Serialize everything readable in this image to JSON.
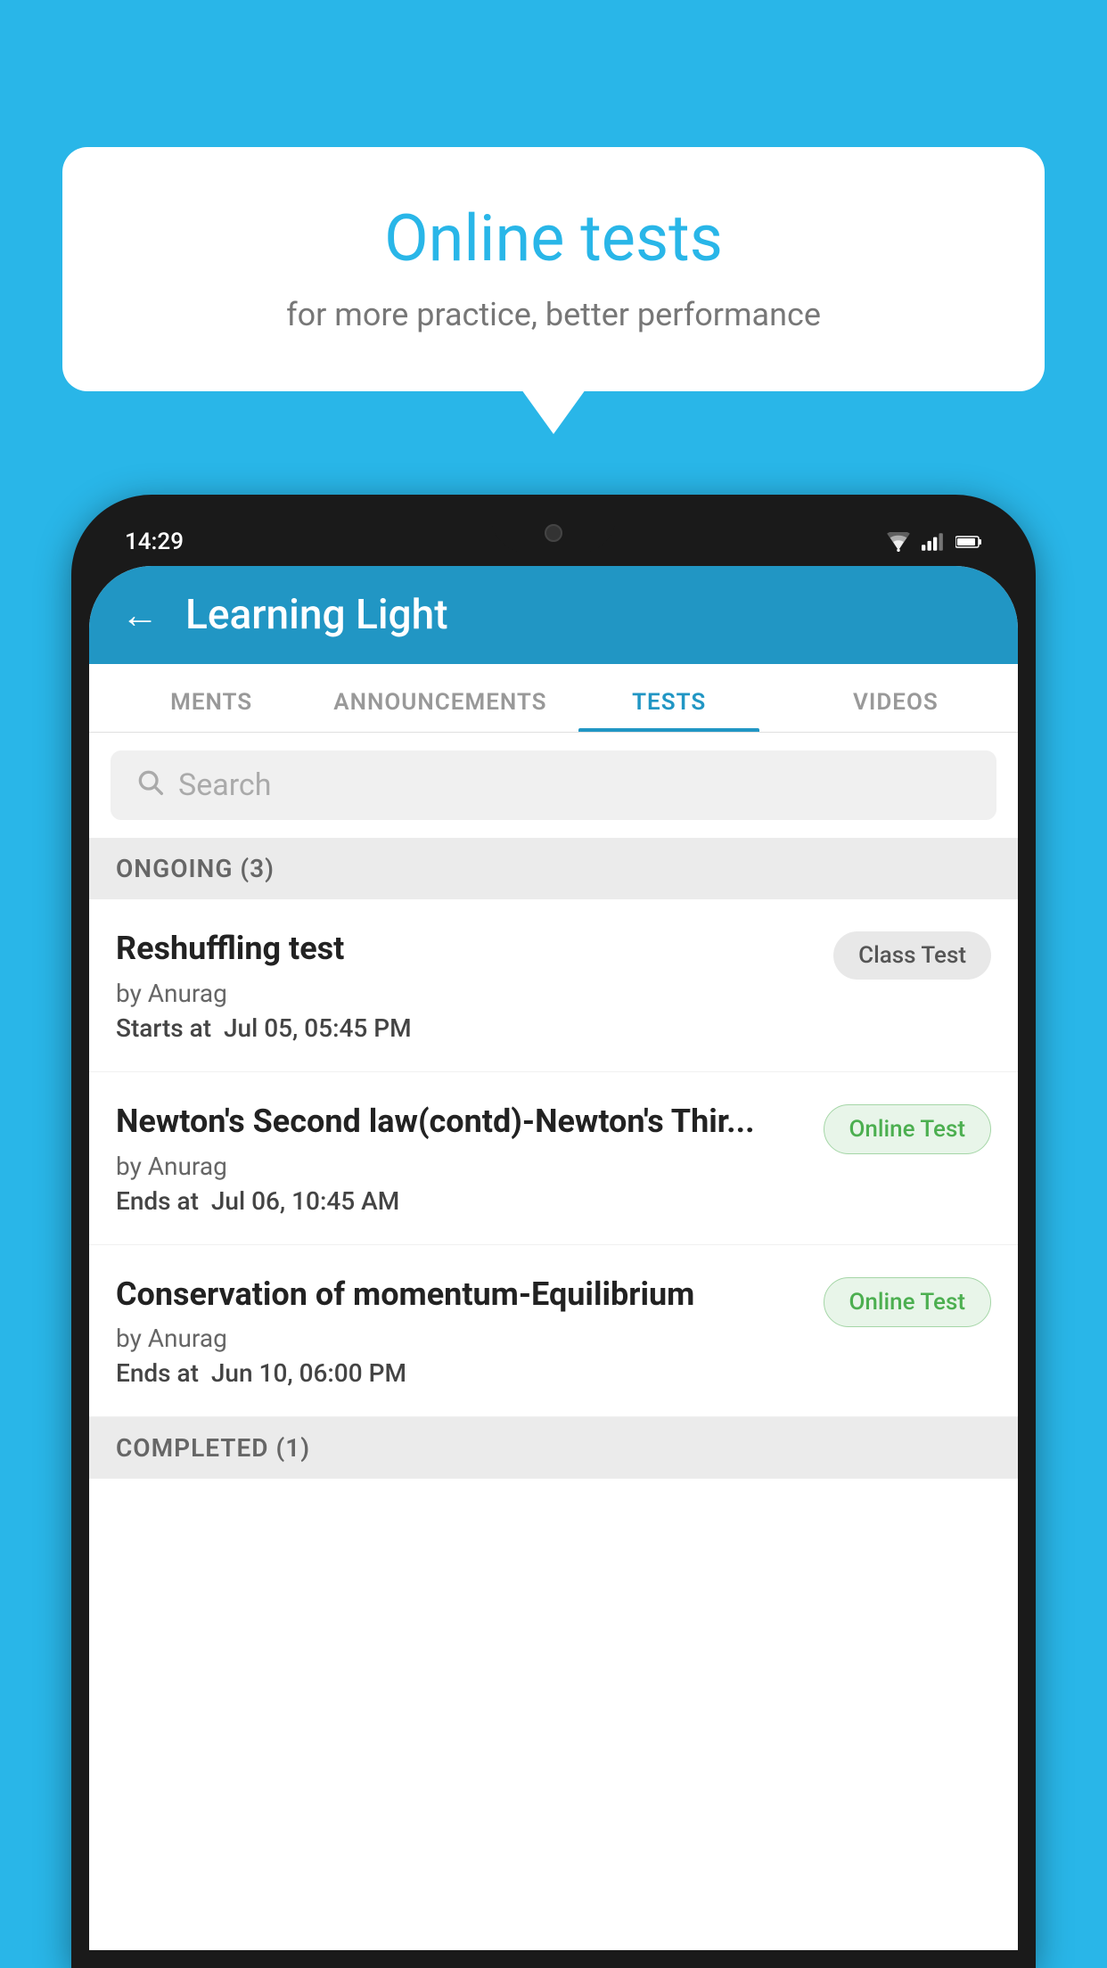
{
  "background_color": "#29b6e8",
  "speech_bubble": {
    "title": "Online tests",
    "subtitle": "for more practice, better performance"
  },
  "phone": {
    "status_bar": {
      "time": "14:29",
      "icons": [
        "wifi",
        "signal",
        "battery"
      ]
    },
    "header": {
      "back_label": "←",
      "title": "Learning Light"
    },
    "tabs": [
      {
        "label": "MENTS",
        "active": false
      },
      {
        "label": "ANNOUNCEMENTS",
        "active": false
      },
      {
        "label": "TESTS",
        "active": true
      },
      {
        "label": "VIDEOS",
        "active": false
      }
    ],
    "search": {
      "placeholder": "Search"
    },
    "ongoing_section": {
      "label": "ONGOING (3)"
    },
    "tests": [
      {
        "name": "Reshuffling test",
        "author": "by Anurag",
        "date_label": "Starts at",
        "date": "Jul 05, 05:45 PM",
        "badge": "Class Test",
        "badge_type": "class"
      },
      {
        "name": "Newton's Second law(contd)-Newton's Thir...",
        "author": "by Anurag",
        "date_label": "Ends at",
        "date": "Jul 06, 10:45 AM",
        "badge": "Online Test",
        "badge_type": "online"
      },
      {
        "name": "Conservation of momentum-Equilibrium",
        "author": "by Anurag",
        "date_label": "Ends at",
        "date": "Jun 10, 06:00 PM",
        "badge": "Online Test",
        "badge_type": "online"
      }
    ],
    "completed_section": {
      "label": "COMPLETED (1)"
    }
  }
}
